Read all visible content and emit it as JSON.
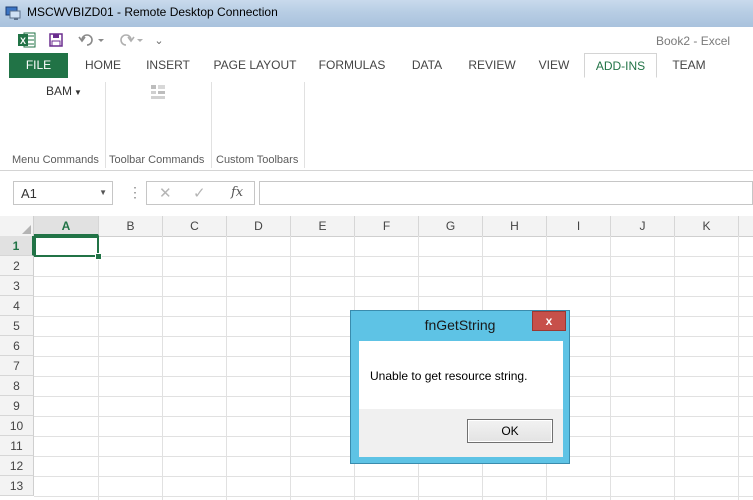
{
  "rdp": {
    "title": "MSCWVBIZD01 - Remote Desktop Connection"
  },
  "excel": {
    "app_title": "Book2 - Excel",
    "customize_qat": "⌄"
  },
  "tabs": [
    {
      "label": "FILE"
    },
    {
      "label": "HOME"
    },
    {
      "label": "INSERT"
    },
    {
      "label": "PAGE LAYOUT"
    },
    {
      "label": "FORMULAS"
    },
    {
      "label": "DATA"
    },
    {
      "label": "REVIEW"
    },
    {
      "label": "VIEW"
    },
    {
      "label": "ADD-INS"
    },
    {
      "label": "TEAM"
    }
  ],
  "active_tab": "ADD-INS",
  "ribbon": {
    "bam_label": "BAM",
    "groups": [
      {
        "label": "Menu Commands"
      },
      {
        "label": "Toolbar Commands"
      },
      {
        "label": "Custom Toolbars"
      }
    ]
  },
  "formula_bar": {
    "name_box": "A1",
    "fx": "fx",
    "formula_value": ""
  },
  "grid": {
    "columns": [
      "A",
      "B",
      "C",
      "D",
      "E",
      "F",
      "G",
      "H",
      "I",
      "J",
      "K"
    ],
    "rows": [
      "1",
      "2",
      "3",
      "4",
      "5",
      "6",
      "7",
      "8",
      "9",
      "10",
      "11",
      "12",
      "13"
    ],
    "selected_cell": "A1"
  },
  "dialog": {
    "title": "fnGetString",
    "message": "Unable to get resource string.",
    "ok_label": "OK",
    "close_glyph": "x"
  },
  "colors": {
    "excel_green": "#217346",
    "dialog_frame": "#5ec3e5",
    "close_red": "#c7504a"
  }
}
